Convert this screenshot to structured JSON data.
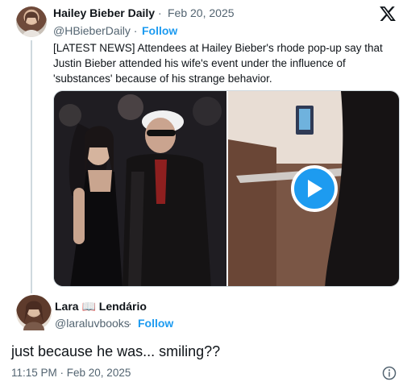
{
  "quoted": {
    "name": "Hailey Bieber Daily",
    "separator": "·",
    "date": "Feb 20, 2025",
    "handle": "@HBieberDaily ·",
    "follow": "Follow",
    "text": "[LATEST NEWS] Attendees at Hailey Bieber's rhode pop-up say that Justin Bieber attended his wife's event under the influence of 'substances' because of his strange behavior.",
    "avatar_icon": "user-avatar",
    "brand_icon": "x-logo-icon"
  },
  "media": {
    "play_icon": "play-icon",
    "accent": "#1d9bf0"
  },
  "reply": {
    "name": "Lara 📖 Lendário",
    "handle": "@laraluvbooks",
    "separator": "·",
    "follow": "Follow",
    "text": "just because he was... smiling??",
    "timestamp": "11:15 PM · Feb 20, 2025",
    "info_icon": "info-icon"
  }
}
